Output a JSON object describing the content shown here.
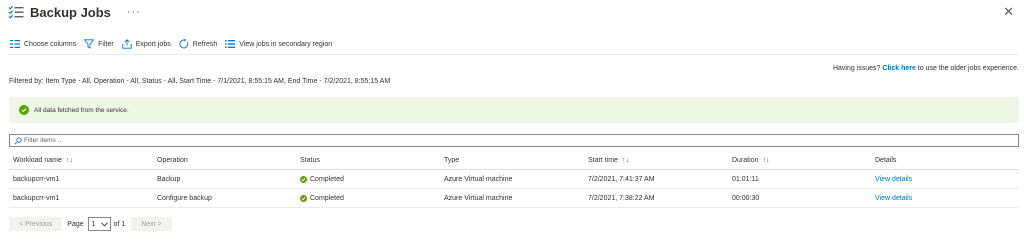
{
  "header": {
    "title": "Backup Jobs",
    "more_label": "···",
    "close_label": "✕"
  },
  "toolbar": {
    "choose_columns": "Choose columns",
    "filter": "Filter",
    "export_jobs": "Export jobs",
    "refresh": "Refresh",
    "secondary_region": "View jobs in secondary region"
  },
  "issue_note": {
    "prefix": "Having issues?",
    "link": "Click here",
    "suffix": "to use the older jobs experience."
  },
  "filter_summary": "Filtered by: Item Type - All, Operation - All, Status - All, Start Time - 7/1/2021, 8:55:15 AM, End Time - 7/2/2021, 8:55:15 AM",
  "banner": {
    "text": "All data fetched from the service.",
    "color": "#57a300"
  },
  "search": {
    "placeholder": "Filter items ..."
  },
  "table": {
    "columns": [
      "Workload name",
      "Operation",
      "Status",
      "Type",
      "Start time",
      "Duration",
      "Details"
    ],
    "sort_glyph": "↑↓",
    "rows": [
      {
        "workload": "backupcrr-vm1",
        "operation": "Backup",
        "status": "Completed",
        "type": "Azure Virtual machine",
        "start": "7/2/2021, 7:41:37 AM",
        "duration": "01:01:11",
        "details": "View details"
      },
      {
        "workload": "backupcrr-vm1",
        "operation": "Configure backup",
        "status": "Completed",
        "type": "Azure Virtual machine",
        "start": "7/2/2021, 7:38:22 AM",
        "duration": "00:00:30",
        "details": "View details"
      }
    ]
  },
  "pager": {
    "previous": "< Previous",
    "page_label": "Page",
    "page_value": "1",
    "of_label": "of 1",
    "next": "Next >"
  },
  "colors": {
    "accent": "#0078d4",
    "success": "#57a300"
  }
}
